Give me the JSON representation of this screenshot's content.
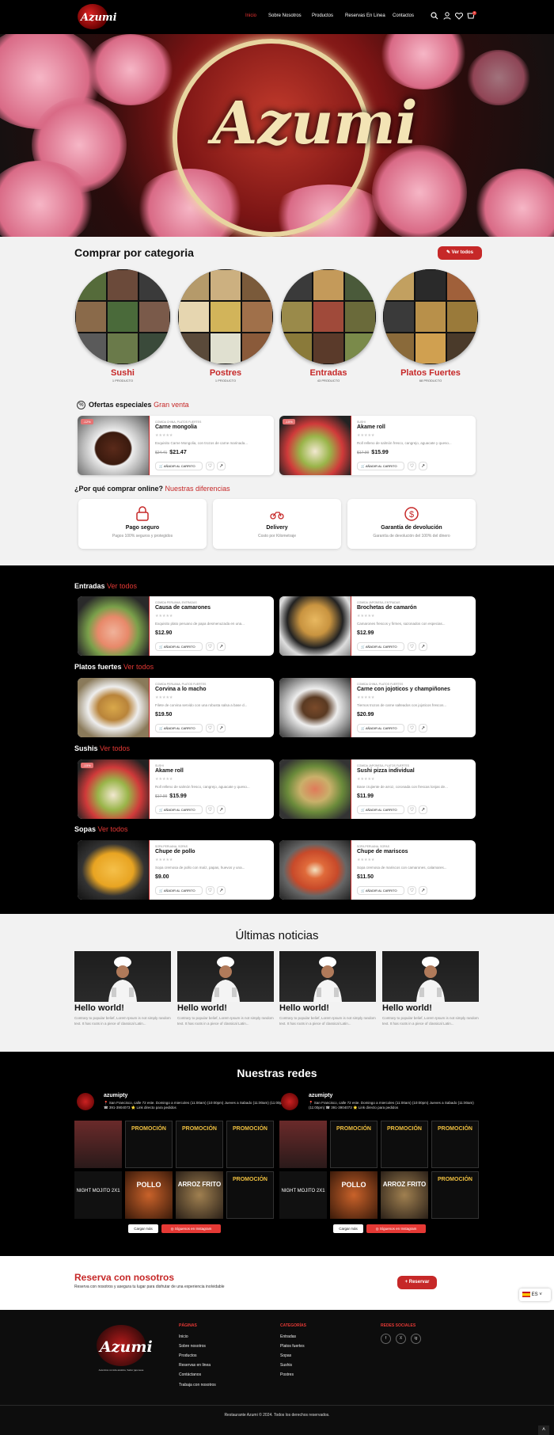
{
  "header": {
    "logo_text": "Azumi",
    "nav": [
      "Inicio",
      "Sobre Nosotros",
      "Productos",
      "Reservas En Linea",
      "Contactos"
    ],
    "cart_count": "0"
  },
  "hero": {
    "sign_text": "Azumi"
  },
  "categories": {
    "title": "Comprar por categoria",
    "view_all": "Ver todos",
    "items": [
      {
        "name": "Sushi",
        "count": "1 PRODUCTO"
      },
      {
        "name": "Postres",
        "count": "1 PRODUCTO"
      },
      {
        "name": "Entradas",
        "count": "43 PRODUCTO"
      },
      {
        "name": "Platos Fuertes",
        "count": "68 PRODUCTO"
      }
    ]
  },
  "offers": {
    "title": "Ofertas especiales",
    "highlight": "Gran venta",
    "items": [
      {
        "badge": "-12%",
        "cat": "COMIDA CHINA, PLATOS FUERTES",
        "name": "Carne mongolia",
        "desc": "Exquisito Carne Mongolia, con trozos de carne marinada...",
        "old": "$24.41",
        "price": "$21.47"
      },
      {
        "badge": "-15%",
        "cat": "SUSHI",
        "name": "Akame roll",
        "desc": "Roll relleno de salmón fresco, cangrejo, aguacate y queso...",
        "old": "$17.99",
        "price": "$15.99"
      }
    ]
  },
  "why": {
    "title": "¿Por qué comprar online?",
    "highlight": "Nuestras diferencias",
    "items": [
      {
        "title": "Pago seguro",
        "sub": "Pagos 100% seguros y protegidos"
      },
      {
        "title": "Delivery",
        "sub": "Costo por Kilometraje"
      },
      {
        "title": "Garantía de devolución",
        "sub": "Garantía de devolución del 100% del dinero"
      }
    ]
  },
  "product_sections": [
    {
      "title": "Entradas",
      "link": "Ver todos",
      "items": [
        {
          "badge": "",
          "cat": "COMIDA PERUANA, ENTRADAS",
          "name": "Causa de camarones",
          "desc": "Exquisito plato peruano de papa desmenuzada en una...",
          "old": "",
          "price": "$12.90"
        },
        {
          "badge": "",
          "cat": "COMIDA JAPONESA, ENTRADAS",
          "name": "Brochetas de camarón",
          "desc": "Camarones frescos y firmes, sazonados con especias...",
          "old": "",
          "price": "$12.99"
        }
      ]
    },
    {
      "title": "Platos fuertes",
      "link": "Ver todos",
      "items": [
        {
          "badge": "",
          "cat": "COMIDA PERUANA, PLATOS FUERTES",
          "name": "Corvina a lo macho",
          "desc": "Filete de corvina servido con una robusta salsa a base d...",
          "old": "",
          "price": "$19.50"
        },
        {
          "badge": "",
          "cat": "COMIDA CHINA, PLATOS FUERTES",
          "name": "Carne con jojoticos y champiñones",
          "desc": "Tiernos trozos de carne salteados con jojoticos frescos...",
          "old": "",
          "price": "$20.99"
        }
      ]
    },
    {
      "title": "Sushis",
      "link": "Ver todos",
      "items": [
        {
          "badge": "-15%",
          "cat": "SUSHI",
          "name": "Akame roll",
          "desc": "Roll relleno de salmón fresco, cangrejo, aguacate y queso...",
          "old": "$17.99",
          "price": "$15.99"
        },
        {
          "badge": "",
          "cat": "COMIDA JAPONESA, PLATOS FUERTES",
          "name": "Sushi pizza individual",
          "desc": "Base crujiente de arroz, coronada con frescas lonjas de...",
          "old": "",
          "price": "$11.99"
        }
      ]
    },
    {
      "title": "Sopas",
      "link": "Ver todos",
      "items": [
        {
          "badge": "",
          "cat": "SOPA PERUANA, SOPAS",
          "name": "Chupe de pollo",
          "desc": "Sopa cremosa de pollo con maíz, papas, huevos y una...",
          "old": "",
          "price": "$9.00"
        },
        {
          "badge": "",
          "cat": "SOPA PERUANA, SOPAS",
          "name": "Chupe de mariscos",
          "desc": "Sopa cremosa de mariscos con camarones, calamares...",
          "old": "",
          "price": "$11.50"
        }
      ]
    }
  ],
  "card_labels": {
    "add_to_cart": "AÑADIR AL CARRITO",
    "stars": "★★★★★"
  },
  "news": {
    "title": "Últimas noticias",
    "items": [
      {
        "title": "Hello world!",
        "desc": "Contrary to popular belief, Lorem Ipsum is not simply random text. It has roots in a piece of classical Latin..."
      },
      {
        "title": "Hello world!",
        "desc": "Contrary to popular belief, Lorem Ipsum is not simply random text. It has roots in a piece of classical Latin..."
      },
      {
        "title": "Hello world!",
        "desc": "Contrary to popular belief, Lorem Ipsum is not simply random text. It has roots in a piece of classical Latin..."
      },
      {
        "title": "Hello world!",
        "desc": "Contrary to popular belief, Lorem Ipsum is not simply random text. It has roots in a piece of classical Latin..."
      }
    ]
  },
  "social": {
    "title": "Nuestras redes",
    "account": "azumipty",
    "bio": "📍 San Francisco, calle 72 este. Domingo a miercoles (11:00am) (10:00pm) Jueves a Sabado (11:00am) (11:00pm) ☎ 391-3904073 ⭐ Link directo para pedidos",
    "load_more": "Cargar más",
    "follow": "Síguenos en Instagram",
    "tiles": [
      "PROMOCIÓN",
      "PROMOCIÓN",
      "PROMOCIÓN",
      "NIGHT MOJITO 2X1",
      "POLLO",
      "ARROZ FRITO",
      "PROMOCIÓN"
    ]
  },
  "reserve": {
    "title": "Reserva con nosotros",
    "sub": "Reserva con nosotros y asegura tu lugar para disfrutar de una experiencia inolvidable",
    "button": "Reservar",
    "lang": "ES"
  },
  "footer": {
    "logo_text": "Azumi",
    "logo_sub": "Auténtica comida asiática, Sabor japonesa",
    "col1": {
      "title": "PÁGINAS",
      "links": [
        "Inicio",
        "Sobre nosotros",
        "Productos",
        "Reservas en linea",
        "Contáctanos",
        "Trabaja con nosotros"
      ]
    },
    "col2": {
      "title": "CATEGORÍAS",
      "links": [
        "Entradas",
        "Platos fuertes",
        "Sopas",
        "Sushis",
        "Postres"
      ]
    },
    "col3": {
      "title": "REDES SOCIALES",
      "icons": [
        "f",
        "X",
        "ig"
      ]
    },
    "copyright": "Restaurante Azumi © 2024. Todos los derechos reservados."
  },
  "colors": {
    "brand_red": "#c62828",
    "dark": "#000000",
    "light_bg": "#f2f2f2"
  }
}
